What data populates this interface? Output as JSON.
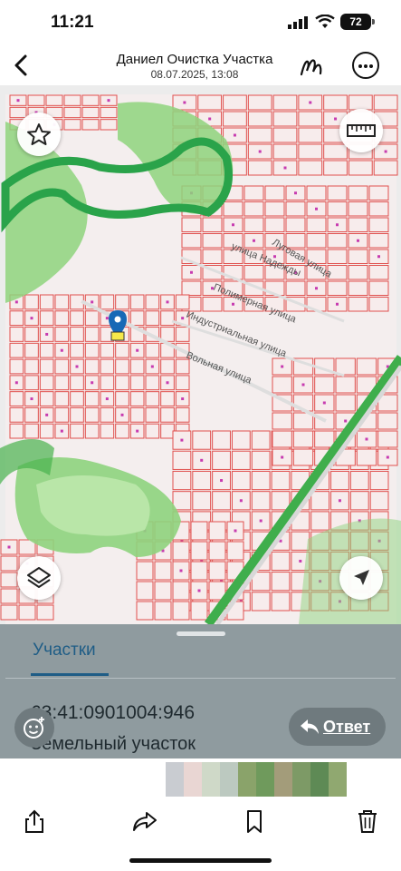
{
  "status_bar": {
    "time": "11:21",
    "battery": "72"
  },
  "header": {
    "title": "Даниел Очистка Участка",
    "subtitle": "08.07.2025, 13:08"
  },
  "map": {
    "street_labels": [
      "Луговая улица",
      "улица Надежды",
      "Полимерная улица",
      "Индустриальная улица",
      "Вольная улица"
    ],
    "icons": {
      "favorite": "star-icon",
      "measure": "ruler-icon",
      "layers": "layers-icon",
      "locate": "navigation-arrow-icon",
      "marker": "location-pin-icon"
    },
    "colors": {
      "parcel_stroke": "#e0504e",
      "parcel_fill": "#f7ecec",
      "forest": "#49b24d",
      "river": "#1e9b43",
      "road": "#d6d6d6"
    }
  },
  "sheet": {
    "tab_label": "Участки",
    "cadastral_number": "63:41:0901004:946",
    "land_type": "Земельный участок"
  },
  "reply_button": {
    "label": "Ответ",
    "icon": "reply-arrow-icon"
  },
  "emoji_button": {
    "icon": "emoji-add-icon"
  },
  "toolbar": {
    "icons": [
      "share-icon",
      "forward-icon",
      "bookmark-icon",
      "trash-icon"
    ]
  },
  "thumbnails": [
    {
      "color": "#c9ccd1"
    },
    {
      "color": "#e9d6d3"
    },
    {
      "color": "#cfd9c8"
    },
    {
      "color": "#bcc9c0"
    },
    {
      "color": "#8aa36a"
    },
    {
      "color": "#6f9a5c"
    },
    {
      "color": "#a39c7a"
    },
    {
      "color": "#7d9a66"
    },
    {
      "color": "#5e8a55"
    },
    {
      "color": "#90a870"
    }
  ]
}
